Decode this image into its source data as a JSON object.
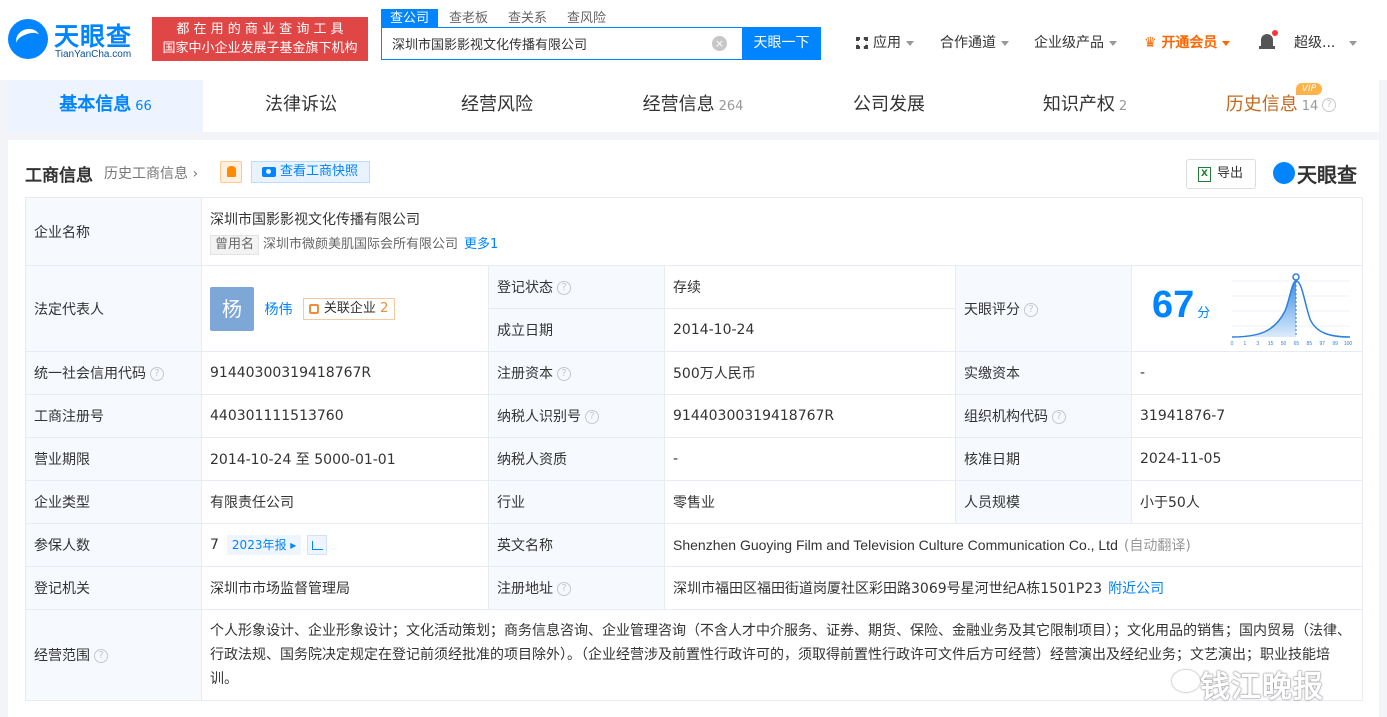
{
  "header": {
    "logo_text": "天眼查",
    "logo_sub": "TianYanCha.com",
    "slogan_line1": "都 在 用 的 商 业 查 询 工 具",
    "slogan_line2": "国家中小企业发展子基金旗下机构",
    "search_tabs": [
      "查公司",
      "查老板",
      "查关系",
      "查风险"
    ],
    "search_value": "深圳市国影影视文化传播有限公司",
    "search_button": "天眼一下",
    "nav": {
      "apps": "应用",
      "channel": "合作通道",
      "enterprise": "企业级产品",
      "vip": "开通会员",
      "user": "超级..."
    }
  },
  "tabs": [
    {
      "label": "基本信息",
      "count": "66"
    },
    {
      "label": "法律诉讼",
      "count": ""
    },
    {
      "label": "经营风险",
      "count": ""
    },
    {
      "label": "经营信息",
      "count": "264"
    },
    {
      "label": "公司发展",
      "count": ""
    },
    {
      "label": "知识产权",
      "count": "2"
    },
    {
      "label": "历史信息",
      "count": "14"
    }
  ],
  "vip_badge": "VIP",
  "section": {
    "title": "工商信息",
    "history_link": "历史工商信息",
    "snapshot_button": "查看工商快照",
    "export_button": "导出",
    "brand": "天眼查"
  },
  "info": {
    "company_name_label": "企业名称",
    "company_name": "深圳市国影影视文化传播有限公司",
    "former_name_tag": "曾用名",
    "former_name": "深圳市微颜美肌国际会所有限公司",
    "more_link": "更多1",
    "legal_rep_label": "法定代表人",
    "legal_rep_avatar": "杨",
    "legal_rep_name": "杨伟",
    "related_label": "关联企业",
    "related_count": "2",
    "reg_status_label": "登记状态",
    "reg_status": "存续",
    "founded_label": "成立日期",
    "founded": "2014-10-24",
    "score_label": "天眼评分",
    "score": "67",
    "score_unit": "分",
    "score_axis": [
      "0",
      "1",
      "3",
      "15",
      "50",
      "65",
      "85",
      "97",
      "99",
      "100"
    ],
    "credit_code_label": "统一社会信用代码",
    "credit_code": "91440300319418767R",
    "reg_capital_label": "注册资本",
    "reg_capital": "500万人民币",
    "paid_capital_label": "实缴资本",
    "paid_capital": "-",
    "reg_no_label": "工商注册号",
    "reg_no": "440301111513760",
    "taxpayer_id_label": "纳税人识别号",
    "taxpayer_id": "91440300319418767R",
    "org_code_label": "组织机构代码",
    "org_code": "31941876-7",
    "term_label": "营业期限",
    "term": "2014-10-24 至 5000-01-01",
    "taxpayer_qual_label": "纳税人资质",
    "taxpayer_qual": "-",
    "approve_date_label": "核准日期",
    "approve_date": "2024-11-05",
    "type_label": "企业类型",
    "type": "有限责任公司",
    "industry_label": "行业",
    "industry": "零售业",
    "staff_label": "人员规模",
    "staff": "小于50人",
    "insured_label": "参保人数",
    "insured": "7",
    "report_tag": "2023年报",
    "english_label": "英文名称",
    "english_name": "Shenzhen Guoying Film and Television Culture Communication Co., Ltd",
    "auto_translate": "(自动翻译)",
    "authority_label": "登记机关",
    "authority": "深圳市市场监督管理局",
    "address_label": "注册地址",
    "address": "深圳市福田区福田街道岗厦社区彩田路3069号星河世纪A栋1501P23",
    "nearby_link": "附近公司",
    "scope_label": "经营范围",
    "scope": "个人形象设计、企业形象设计；文化活动策划；商务信息咨询、企业管理咨询（不含人才中介服务、证券、期货、保险、金融业务及其它限制项目）；文化用品的销售；国内贸易（法律、行政法规、国务院决定规定在登记前须经批准的项目除外）。（企业经营涉及前置性行政许可的，须取得前置性行政许可文件后方可经营）经营演出及经纪业务；文艺演出；职业技能培训。"
  },
  "watermark": "钱江晚报"
}
